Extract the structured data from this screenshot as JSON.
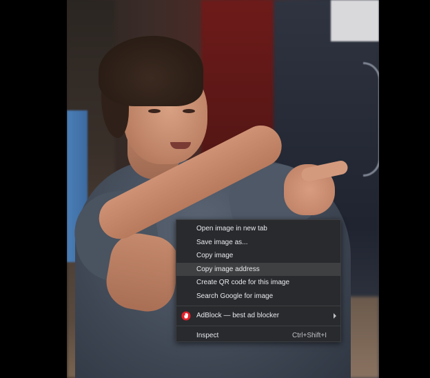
{
  "context_menu": {
    "items": [
      {
        "label": "Open image in new tab"
      },
      {
        "label": "Save image as..."
      },
      {
        "label": "Copy image"
      },
      {
        "label": "Copy image address"
      },
      {
        "label": "Create QR code for this image"
      },
      {
        "label": "Search Google for image"
      }
    ],
    "extension": {
      "label": "AdBlock — best ad blocker",
      "icon": "adblock-hand-icon",
      "icon_color": "#e4202a"
    },
    "inspect": {
      "label": "Inspect",
      "shortcut": "Ctrl+Shift+I"
    }
  },
  "colors": {
    "menu_background": "#292a2d",
    "menu_highlight": "#3f4042",
    "menu_text": "#e8eaed"
  }
}
